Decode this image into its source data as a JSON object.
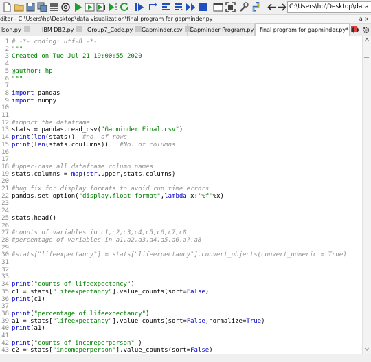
{
  "toolbar": {
    "path": "C:\\Users\\hp\\Desktop\\data visualization",
    "icons": [
      "new-file-icon",
      "open-folder-icon",
      "save-icon",
      "save-all-icon",
      "list-icon",
      "at-icon",
      "run-icon",
      "run-cell-icon",
      "run-cell-advance-icon",
      "run-selection-icon",
      "rerun-icon",
      "debug-icon",
      "step-icon",
      "step-into-icon",
      "step-return-icon",
      "continue-icon",
      "stop-icon",
      "maximize-pane-icon",
      "fullscreen-icon",
      "tools-icon",
      "python-path-icon",
      "back-arrow-icon",
      "forward-arrow-icon"
    ]
  },
  "title": {
    "text": "ditor - C:\\Users\\hp\\Desktop\\data visualization\\final program for gapminder.py",
    "controls": "á ×"
  },
  "tabs": [
    {
      "label": "lson.py"
    },
    {
      "label": "IBM DB2.py"
    },
    {
      "label": "Group7_Code.py"
    },
    {
      "label": "Gapminder.csv"
    },
    {
      "label": "Gapminder Program.py"
    },
    {
      "label": "final program for gapminder.py*",
      "active": true
    }
  ],
  "editor": {
    "lines": [
      {
        "n": "1",
        "segs": [
          {
            "c": "c-comment",
            "t": "# -*- coding: utf-8 -*-"
          }
        ]
      },
      {
        "n": "2",
        "segs": [
          {
            "c": "c-doc",
            "t": "\"\"\""
          }
        ]
      },
      {
        "n": "3",
        "segs": [
          {
            "c": "c-doc",
            "t": "Created on Tue Jul 21 19:00:55 2020"
          }
        ]
      },
      {
        "n": "4",
        "segs": []
      },
      {
        "n": "5",
        "segs": [
          {
            "c": "c-doc",
            "t": "@author: hp"
          }
        ]
      },
      {
        "n": "6",
        "segs": [
          {
            "c": "c-doc",
            "t": "\"\"\""
          }
        ]
      },
      {
        "n": "7",
        "segs": []
      },
      {
        "n": "8",
        "segs": [
          {
            "c": "c-kw",
            "t": "import"
          },
          {
            "c": "",
            "t": " pandas"
          }
        ]
      },
      {
        "n": "9",
        "segs": [
          {
            "c": "c-kw",
            "t": "import"
          },
          {
            "c": "",
            "t": " numpy"
          }
        ]
      },
      {
        "n": "10",
        "segs": []
      },
      {
        "n": "11",
        "segs": []
      },
      {
        "n": "12",
        "segs": [
          {
            "c": "c-comment",
            "t": "#import the dataframe"
          }
        ]
      },
      {
        "n": "13",
        "segs": [
          {
            "c": "",
            "t": "stats = pandas.read_csv("
          },
          {
            "c": "c-string",
            "t": "\"Gapminder Final.csv\""
          },
          {
            "c": "",
            "t": ")"
          }
        ]
      },
      {
        "n": "14",
        "segs": [
          {
            "c": "c-kw",
            "t": "print"
          },
          {
            "c": "",
            "t": "("
          },
          {
            "c": "c-kw",
            "t": "len"
          },
          {
            "c": "",
            "t": "(stats))  "
          },
          {
            "c": "c-comment",
            "t": "#no. of rows"
          }
        ]
      },
      {
        "n": "15",
        "segs": [
          {
            "c": "c-kw",
            "t": "print"
          },
          {
            "c": "",
            "t": "("
          },
          {
            "c": "c-kw",
            "t": "len"
          },
          {
            "c": "",
            "t": "(stats.coulumns))   "
          },
          {
            "c": "c-comment",
            "t": "#No. of columns"
          }
        ]
      },
      {
        "n": "16",
        "segs": []
      },
      {
        "n": "17",
        "segs": []
      },
      {
        "n": "18",
        "segs": [
          {
            "c": "c-comment",
            "t": "#upper-case all dataframe column names"
          }
        ]
      },
      {
        "n": "19",
        "segs": [
          {
            "c": "",
            "t": "stats.columns = "
          },
          {
            "c": "c-kw",
            "t": "map"
          },
          {
            "c": "",
            "t": "("
          },
          {
            "c": "c-kw",
            "t": "str"
          },
          {
            "c": "",
            "t": ".upper,stats.columns)"
          }
        ]
      },
      {
        "n": "20",
        "segs": []
      },
      {
        "n": "21",
        "segs": [
          {
            "c": "c-comment",
            "t": "#bug fix for display formats to avoid run time errors"
          }
        ]
      },
      {
        "n": "22",
        "segs": [
          {
            "c": "",
            "t": "pandas.set_option("
          },
          {
            "c": "c-string",
            "t": "\"display.float_format\""
          },
          {
            "c": "",
            "t": ","
          },
          {
            "c": "c-kw",
            "t": "lambda"
          },
          {
            "c": "",
            "t": " x:"
          },
          {
            "c": "c-string",
            "t": "'%f'"
          },
          {
            "c": "",
            "t": "%x)"
          }
        ]
      },
      {
        "n": "23",
        "segs": []
      },
      {
        "n": "24",
        "segs": []
      },
      {
        "n": "25",
        "segs": [
          {
            "c": "",
            "t": "stats.head()"
          }
        ]
      },
      {
        "n": "26",
        "segs": []
      },
      {
        "n": "27",
        "segs": [
          {
            "c": "c-comment",
            "t": "#counts of variables in c1,c2,c3,c4,c5,c6,c7,c8"
          }
        ]
      },
      {
        "n": "28",
        "segs": [
          {
            "c": "c-comment",
            "t": "#percentage of variables in a1,a2,a3,a4,a5,a6,a7,a8"
          }
        ]
      },
      {
        "n": "29",
        "segs": []
      },
      {
        "n": "30",
        "segs": [
          {
            "c": "c-comment",
            "t": "#stats[\"lifeexpectancy\"] = stats[\"lifeexpectancy\"].convert_objects(convert_numeric = True)"
          }
        ]
      },
      {
        "n": "31",
        "segs": []
      },
      {
        "n": "32",
        "segs": []
      },
      {
        "n": "33",
        "segs": []
      },
      {
        "n": "34",
        "segs": [
          {
            "c": "c-kw",
            "t": "print"
          },
          {
            "c": "",
            "t": "("
          },
          {
            "c": "c-string",
            "t": "\"counts of lifeexpectancy\""
          },
          {
            "c": "",
            "t": ")"
          }
        ]
      },
      {
        "n": "35",
        "segs": [
          {
            "c": "",
            "t": "c1 = stats["
          },
          {
            "c": "c-string",
            "t": "\"lifeexpectancy\""
          },
          {
            "c": "",
            "t": "].value_counts(sort="
          },
          {
            "c": "c-kw",
            "t": "False"
          },
          {
            "c": "",
            "t": ")"
          }
        ]
      },
      {
        "n": "36",
        "segs": [
          {
            "c": "c-kw",
            "t": "print"
          },
          {
            "c": "",
            "t": "(c1)"
          }
        ]
      },
      {
        "n": "37",
        "segs": []
      },
      {
        "n": "38",
        "segs": [
          {
            "c": "c-kw",
            "t": "print"
          },
          {
            "c": "",
            "t": "("
          },
          {
            "c": "c-string",
            "t": "\"percentage of lifeexpectancy\""
          },
          {
            "c": "",
            "t": ")"
          }
        ]
      },
      {
        "n": "39",
        "segs": [
          {
            "c": "",
            "t": "a1 = stats["
          },
          {
            "c": "c-string",
            "t": "\"lifeexpectancy\""
          },
          {
            "c": "",
            "t": "].value_counts(sort="
          },
          {
            "c": "c-kw",
            "t": "False"
          },
          {
            "c": "",
            "t": ",normalize="
          },
          {
            "c": "c-kw",
            "t": "True"
          },
          {
            "c": "",
            "t": ")"
          }
        ]
      },
      {
        "n": "40",
        "segs": [
          {
            "c": "c-kw",
            "t": "print"
          },
          {
            "c": "",
            "t": "(a1)"
          }
        ]
      },
      {
        "n": "41",
        "segs": []
      },
      {
        "n": "42",
        "segs": [
          {
            "c": "c-kw",
            "t": "print"
          },
          {
            "c": "",
            "t": "("
          },
          {
            "c": "c-string",
            "t": "\"counts of incomeperperson\""
          },
          {
            "c": "",
            "t": " )"
          }
        ]
      },
      {
        "n": "43",
        "segs": [
          {
            "c": "",
            "t": "c2 = stats["
          },
          {
            "c": "c-string",
            "t": "\"incomeperperson\""
          },
          {
            "c": "",
            "t": "].value_counts(sort="
          },
          {
            "c": "c-kw",
            "t": "False"
          },
          {
            "c": "",
            "t": ")"
          }
        ]
      }
    ]
  }
}
